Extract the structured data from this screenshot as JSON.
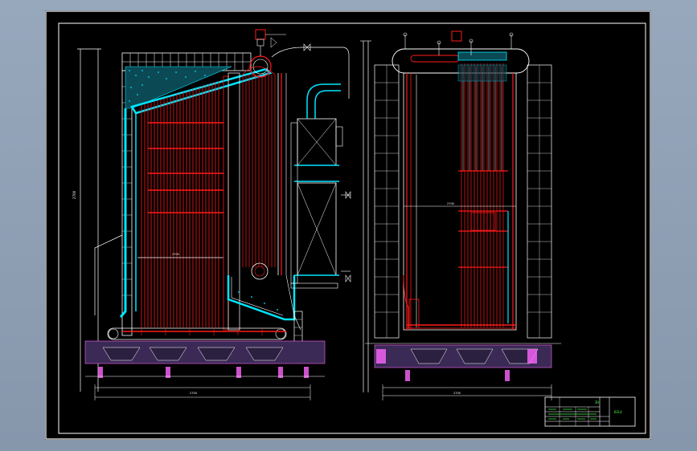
{
  "app": {
    "background_color": "#8e9fb4",
    "viewport_color": "#000000"
  },
  "drawing": {
    "line_colors": {
      "frame": "#ffffff",
      "tubes": "#ff1a1a",
      "insulation": "#00e5ff",
      "duct": "#ffffff",
      "title_block": "#4dff4d"
    },
    "side_view": {
      "dim_labels": [
        "2700",
        "2700",
        "2700"
      ]
    },
    "front_view": {
      "dim_labels": [
        "2700",
        "2700"
      ]
    },
    "title_block": {
      "label_a": "ZH",
      "label_b": "DZL4"
    }
  }
}
